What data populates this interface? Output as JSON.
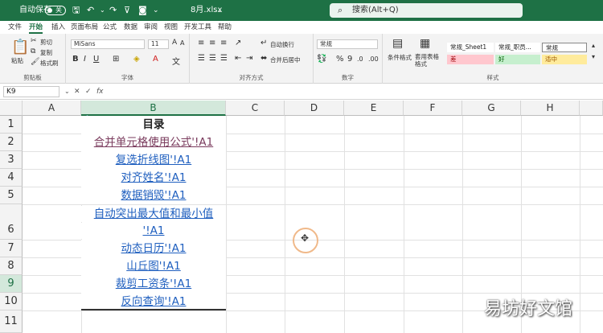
{
  "titlebar": {
    "autosave_label": "自动保存",
    "autosave_state": "关",
    "filename": "8月.xlsx",
    "search_placeholder": "搜索(Alt+Q)"
  },
  "menu": [
    "文件",
    "开始",
    "插入",
    "页面布局",
    "公式",
    "数据",
    "审阅",
    "视图",
    "开发工具",
    "帮助"
  ],
  "ribbon": {
    "clipboard": {
      "paste": "粘贴",
      "cut": "剪切",
      "copy": "复制",
      "format_painter": "格式刷",
      "label": "剪贴板"
    },
    "font": {
      "name": "MiSans",
      "size": "11",
      "label": "字体"
    },
    "alignment": {
      "wrap": "自动换行",
      "merge": "合并后居中",
      "label": "对齐方式"
    },
    "number": {
      "format": "常规",
      "label": "数字"
    },
    "styles": {
      "conditional": "条件格式",
      "table": "套用表格格式",
      "cells": [
        "常规_Sheet1",
        "常规_职员...",
        "常规",
        "差",
        "好",
        "适中"
      ],
      "label": "样式"
    }
  },
  "formula_bar": {
    "namebox": "K9",
    "fx": "fx",
    "content": ""
  },
  "columns": [
    "A",
    "B",
    "C",
    "D",
    "E",
    "F",
    "G",
    "H"
  ],
  "active_column": "B",
  "rows": [
    "1",
    "2",
    "3",
    "4",
    "5",
    "6",
    "7",
    "8",
    "9",
    "10",
    "11"
  ],
  "active_row": "9",
  "cells": {
    "b1": "目录",
    "b2": "合并单元格使用公式'!A1",
    "b3": "复选折线图'!A1",
    "b4": "对齐姓名'!A1",
    "b5": "数据销毁'!A1",
    "b6a": "自动突出最大值和最小值",
    "b6b": "'!A1",
    "b7": "动态日历'!A1",
    "b8": "山丘图'!A1",
    "b9": "裁剪工资条'!A1",
    "b10": "反向查询'!A1"
  },
  "watermark": "易坊好文馆",
  "colors": {
    "accent": "#1e7145",
    "link": "#1f5fbf",
    "visited": "#7a3b5d",
    "bad": "#ffc7ce",
    "good": "#c6efce",
    "neutral": "#ffeb9c"
  }
}
